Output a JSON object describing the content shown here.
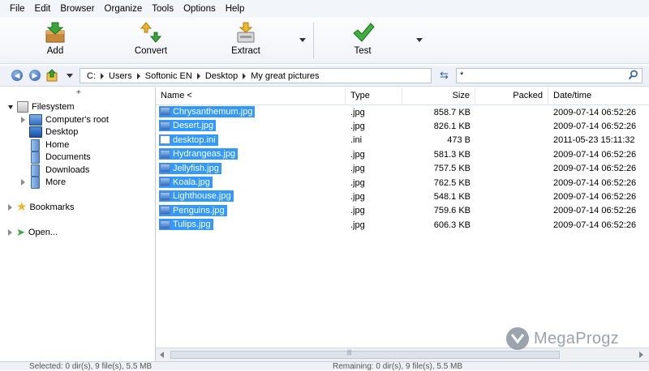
{
  "menu": [
    "File",
    "Edit",
    "Browser",
    "Organize",
    "Tools",
    "Options",
    "Help"
  ],
  "toolbar": {
    "add_label": "Add",
    "convert_label": "Convert",
    "extract_label": "Extract",
    "test_label": "Test"
  },
  "address": {
    "crumbs": [
      "C:",
      "Users",
      "Softonic EN",
      "Desktop",
      "My great pictures"
    ],
    "filter": "*"
  },
  "tree": {
    "collapse_marker": "+",
    "items": [
      {
        "label": "Filesystem"
      },
      {
        "label": "Computer's root"
      },
      {
        "label": "Desktop"
      },
      {
        "label": "Home"
      },
      {
        "label": "Documents"
      },
      {
        "label": "Downloads"
      },
      {
        "label": "More"
      },
      {
        "label": "Bookmarks"
      },
      {
        "label": "Open..."
      }
    ]
  },
  "columns": {
    "name": "Name <",
    "type": "Type",
    "size": "Size",
    "packed": "Packed",
    "date": "Date/time"
  },
  "files": [
    {
      "name": "Chrysanthemum.jpg",
      "type": ".jpg",
      "size": "858.7 KB",
      "date": "2009-07-14 06:52:26"
    },
    {
      "name": "Desert.jpg",
      "type": ".jpg",
      "size": "826.1 KB",
      "date": "2009-07-14 06:52:26"
    },
    {
      "name": "desktop.ini",
      "type": ".ini",
      "size": "473 B",
      "date": "2011-05-23 15:11:32"
    },
    {
      "name": "Hydrangeas.jpg",
      "type": ".jpg",
      "size": "581.3 KB",
      "date": "2009-07-14 06:52:26"
    },
    {
      "name": "Jellyfish.jpg",
      "type": ".jpg",
      "size": "757.5 KB",
      "date": "2009-07-14 06:52:26"
    },
    {
      "name": "Koala.jpg",
      "type": ".jpg",
      "size": "762.5 KB",
      "date": "2009-07-14 06:52:26"
    },
    {
      "name": "Lighthouse.jpg",
      "type": ".jpg",
      "size": "548.1 KB",
      "date": "2009-07-14 06:52:26"
    },
    {
      "name": "Penguins.jpg",
      "type": ".jpg",
      "size": "759.6 KB",
      "date": "2009-07-14 06:52:26"
    },
    {
      "name": "Tulips.jpg",
      "type": ".jpg",
      "size": "606.3 KB",
      "date": "2009-07-14 06:52:26"
    }
  ],
  "status": {
    "left": "Selected: 0 dir(s), 9 file(s), 5.5 MB",
    "right": "Remaining: 0 dir(s), 9 file(s), 5.5 MB"
  },
  "watermark": "MegaProgz",
  "colors": {
    "selection": "#3399ff",
    "nav_blue": "#2f5ea8"
  }
}
